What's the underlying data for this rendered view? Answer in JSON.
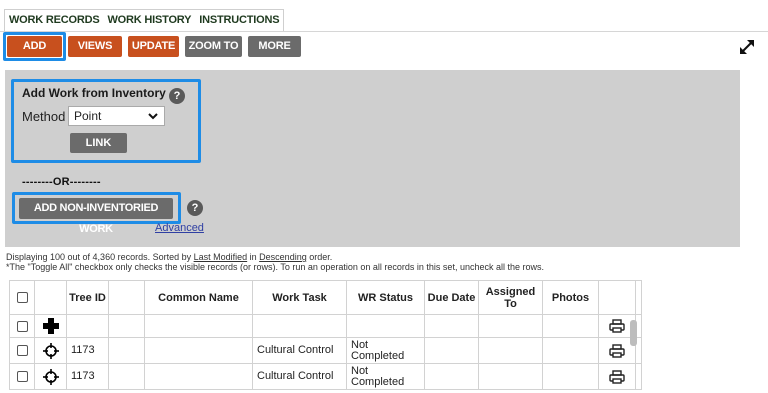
{
  "tabs": [
    {
      "label": "WORK RECORDS",
      "active": true
    },
    {
      "label": "WORK HISTORY",
      "active": false
    },
    {
      "label": "INSTRUCTIONS",
      "active": false
    }
  ],
  "toolbar": {
    "add_label": "ADD",
    "views_label": "VIEWS",
    "update_label": "UPDATE",
    "zoom_label": "ZOOM TO",
    "more_label": "MORE"
  },
  "panel": {
    "title": "Add Work from Inventory",
    "help_glyph": "?",
    "method_label": "Method",
    "method_value": "Point",
    "link_label": "LINK",
    "or_text": "--------OR--------",
    "noninv_label": "ADD NON-INVENTORIED WORK",
    "advanced_label": "Advanced"
  },
  "info": {
    "line1_a": "Displaying 100 out of 4,360 records. Sorted by ",
    "line1_sort": "Last Modified",
    "line1_b": " in ",
    "line1_order": "Descending",
    "line1_c": " order.",
    "line2": "*The \"Toggle All\" checkbox only checks the visible records (or rows). To run an operation on all records in this set, uncheck all the rows."
  },
  "table": {
    "headers": {
      "tree_id": "Tree ID",
      "common_name": "Common Name",
      "work_task": "Work Task",
      "wr_status": "WR Status",
      "due_date": "Due Date",
      "assigned_to": "Assigned To",
      "photos": "Photos"
    },
    "rows": [
      {
        "icon": "plus-icon",
        "tree_id": "",
        "common_name": "",
        "work_task": "",
        "wr_status": "",
        "due_date": "",
        "assigned_to": "",
        "photos": ""
      },
      {
        "icon": "crosshair-icon",
        "tree_id": "1173",
        "common_name": "",
        "work_task": "Cultural Control",
        "wr_status": "Not Completed",
        "due_date": "",
        "assigned_to": "",
        "photos": ""
      },
      {
        "icon": "crosshair-icon",
        "tree_id": "1173",
        "common_name": "",
        "work_task": "Cultural Control",
        "wr_status": "Not Completed",
        "due_date": "",
        "assigned_to": "",
        "photos": ""
      }
    ]
  },
  "colors": {
    "primary_button": "#c8501e",
    "secondary_button": "#6b6b6b",
    "highlight": "#1e8ce6",
    "panel_bg": "#cfcfcf",
    "link": "#2f3fa3"
  }
}
